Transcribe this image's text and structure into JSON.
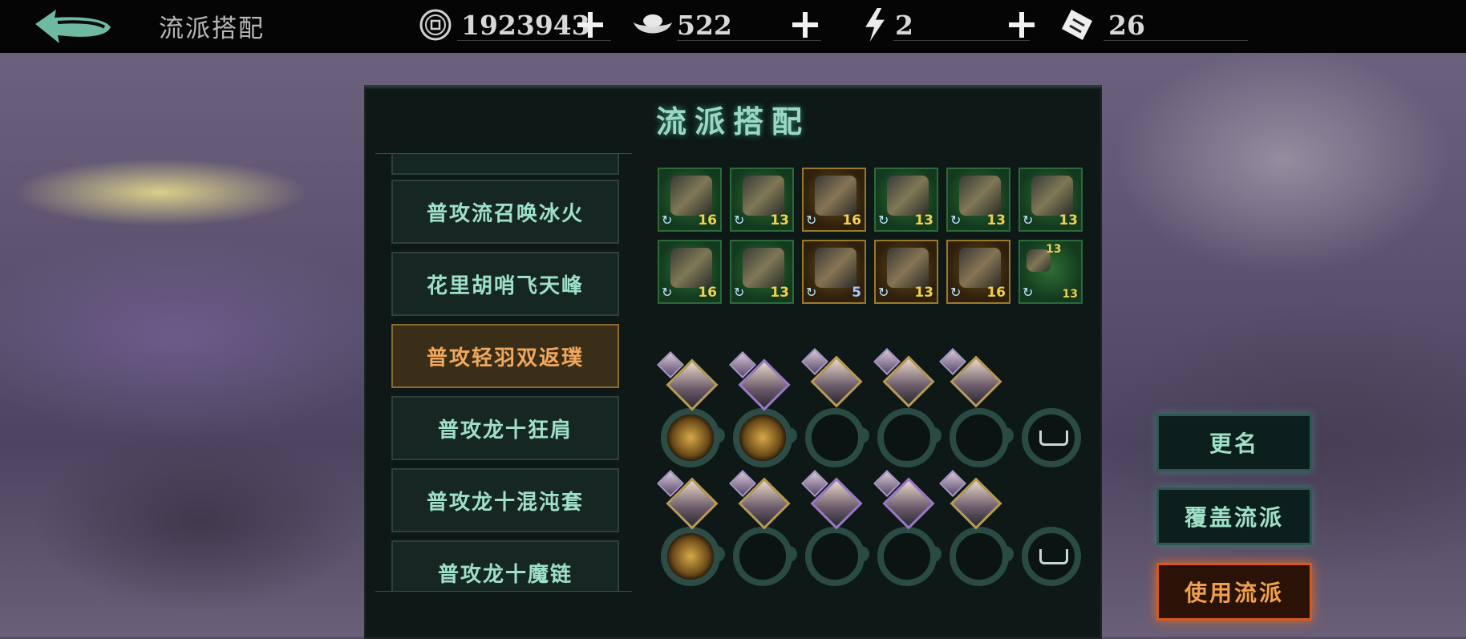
{
  "header": {
    "title": "流派搭配",
    "resources": [
      {
        "icon": "coin-icon",
        "value": "1923943"
      },
      {
        "icon": "silver-ingot-icon",
        "value": "522"
      },
      {
        "icon": "lightning-icon",
        "value": "2"
      },
      {
        "icon": "ticket-icon",
        "value": "26"
      }
    ]
  },
  "panel": {
    "title": "流派搭配",
    "list": [
      {
        "label": ""
      },
      {
        "label": "普攻流召唤冰火"
      },
      {
        "label": "花里胡哨飞天峰"
      },
      {
        "label": "普攻轻羽双返璞",
        "selected": true
      },
      {
        "label": "普攻龙十狂肩"
      },
      {
        "label": "普攻龙十混沌套"
      },
      {
        "label": "普攻龙十魔链"
      }
    ],
    "equipment": [
      {
        "level": "16",
        "rarity": "green"
      },
      {
        "level": "13",
        "rarity": "green"
      },
      {
        "level": "16",
        "rarity": "gold"
      },
      {
        "level": "13",
        "rarity": "green"
      },
      {
        "level": "13",
        "rarity": "green"
      },
      {
        "level": "13",
        "rarity": "green"
      },
      {
        "level": "16",
        "rarity": "green"
      },
      {
        "level": "13",
        "rarity": "green"
      },
      {
        "level": "5",
        "rarity": "gold"
      },
      {
        "level": "13",
        "rarity": "gold"
      },
      {
        "level": "16",
        "rarity": "gold"
      },
      {
        "level": "13",
        "level2": "13",
        "rarity": "green"
      }
    ]
  },
  "buttons": {
    "rename": "更名",
    "overwrite": "覆盖流派",
    "use": "使用流派"
  }
}
